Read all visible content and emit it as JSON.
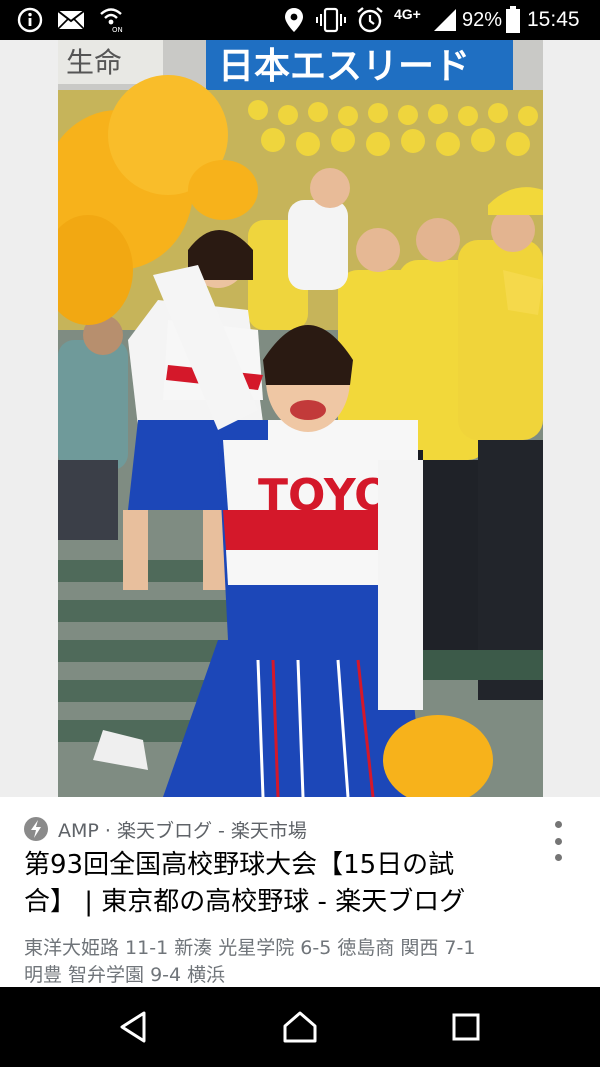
{
  "status_bar": {
    "network": "4G+",
    "battery": "92%",
    "time": "15:45"
  },
  "result": {
    "source": "AMP · 楽天ブログ - 楽天市場",
    "title_line1": "第93回全国高校野球大会【15日の試",
    "title_line2": "合】 | 東京都の高校野球 - 楽天ブログ",
    "snippet_line1": "東洋大姫路 11-1 新湊 光星学院 6-5 徳島商 関西 7-1",
    "snippet_line2": "明豊 智弁学園 9-4 横浜"
  },
  "photo": {
    "banner_text": "日本エスリード",
    "side_text": "生命",
    "uniform_text": "TOYO"
  },
  "colors": {
    "status_bar": "#000000",
    "nav_bar": "#000000",
    "banner": "#1f6fc2",
    "crowd_yellow": "#f2d83a",
    "skirt_blue": "#1c47b8",
    "pom_yellow": "#f7b21b"
  },
  "icons": [
    "info-icon",
    "mail-icon",
    "wifi-calling-icon",
    "location-icon",
    "vibrate-icon",
    "alarm-icon",
    "signal-icon",
    "battery-icon",
    "amp-icon",
    "more-vert-icon",
    "back-icon",
    "home-icon",
    "recents-icon"
  ]
}
